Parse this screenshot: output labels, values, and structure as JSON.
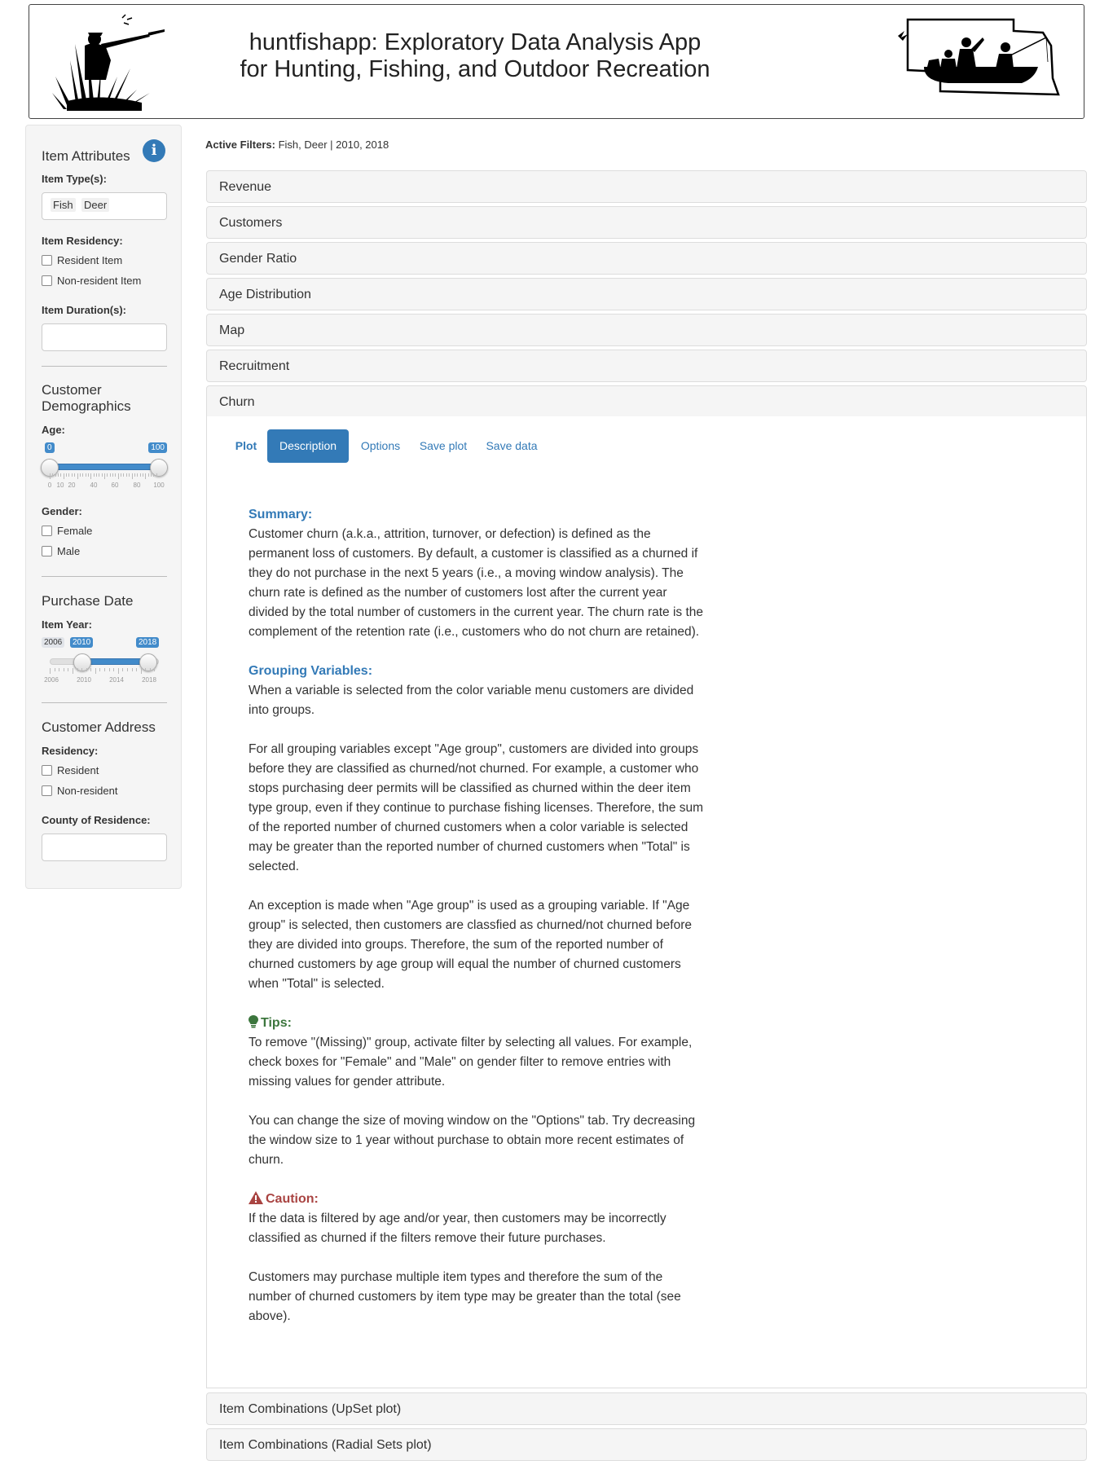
{
  "header": {
    "title_line1": "huntfishapp: Exploratory Data Analysis App",
    "title_line2": "for Hunting, Fishing, and Outdoor Recreation"
  },
  "sidebar": {
    "item_attributes": {
      "title": "Item Attributes",
      "info_icon": "info-icon",
      "item_type_label": "Item Type(s):",
      "item_type_chips": [
        "Fish",
        "Deer"
      ],
      "residency_label": "Item Residency:",
      "residency_options": [
        "Resident Item",
        "Non-resident Item"
      ],
      "duration_label": "Item Duration(s):"
    },
    "customer_demographics": {
      "title_line1": "Customer",
      "title_line2": "Demographics",
      "age_label": "Age:",
      "age_min": "0",
      "age_max": "100",
      "age_ticks": [
        "0",
        "10",
        "20",
        "40",
        "60",
        "80",
        "100"
      ],
      "gender_label": "Gender:",
      "gender_options": [
        "Female",
        "Male"
      ]
    },
    "purchase_date": {
      "title": "Purchase Date",
      "item_year_label": "Item Year:",
      "year_range_min": "2006",
      "year_from": "2010",
      "year_to": "2018",
      "year_ticks": [
        "2006",
        "2010",
        "2014",
        "2018"
      ]
    },
    "customer_address": {
      "title": "Customer Address",
      "residency_label": "Residency:",
      "residency_options": [
        "Resident",
        "Non-resident"
      ],
      "county_label": "County of Residence:"
    }
  },
  "main": {
    "active_filters_label": "Active Filters:",
    "active_filters_value": " Fish, Deer | 2010, 2018",
    "panels": [
      "Revenue",
      "Customers",
      "Gender Ratio",
      "Age Distribution",
      "Map",
      "Recruitment",
      "Churn"
    ],
    "bottom_panels": [
      "Item Combinations (UpSet plot)",
      "Item Combinations (Radial Sets plot)"
    ],
    "tabs": [
      "Plot",
      "Description",
      "Options",
      "Save plot",
      "Save data"
    ],
    "active_tab": "Description",
    "description": {
      "summary_heading": "Summary:",
      "summary_text": "Customer churn (a.k.a., attrition, turnover, or defection) is defined as the permanent loss of customers. By default, a customer is classified as a churned if they do not purchase in the next 5 years (i.e., a moving window analysis). The churn rate is defined as the number of customers lost after the current year divided by the total number of customers in the current year. The churn rate is the complement of the retention rate (i.e., customers who do not churn are retained).",
      "grouping_heading": "Grouping Variables:",
      "grouping_p1": "When a variable is selected from the color variable menu customers are divided into groups.",
      "grouping_p2": "For all grouping variables except \"Age group\", customers are divided into groups before they are classified as churned/not churned. For example, a customer who stops purchasing deer permits will be classified as churned within the deer item type group, even if they continue to purchase fishing licenses. Therefore, the sum of the reported number of churned customers when a color variable is selected may be greater than the reported number of churned customers when \"Total\" is selected.",
      "grouping_p3": "An exception is made when \"Age group\" is used as a grouping variable. If \"Age group\" is selected, then customers are classfied as churned/not churned before they are divided into groups. Therefore, the sum of the reported number of churned customers by age group will equal the number of churned customers when \"Total\" is selected.",
      "tips_heading": "Tips:",
      "tips_p1": "To remove \"(Missing)\" group, activate filter by selecting all values. For example, check boxes for \"Female\" and \"Male\" on gender filter to remove entries with missing values for gender attribute.",
      "tips_p2": "You can change the size of moving window on the \"Options\" tab. Try decreasing the window size to 1 year without purchase to obtain more recent estimates of churn.",
      "caution_heading": "Caution:",
      "caution_p1": "If the data is filtered by age and/or year, then customers may be incorrectly classified as churned if the filters remove their future purchases.",
      "caution_p2": "Customers may purchase multiple item types and therefore the sum of the number of churned customers by item type may be greater than the total (see above)."
    }
  }
}
